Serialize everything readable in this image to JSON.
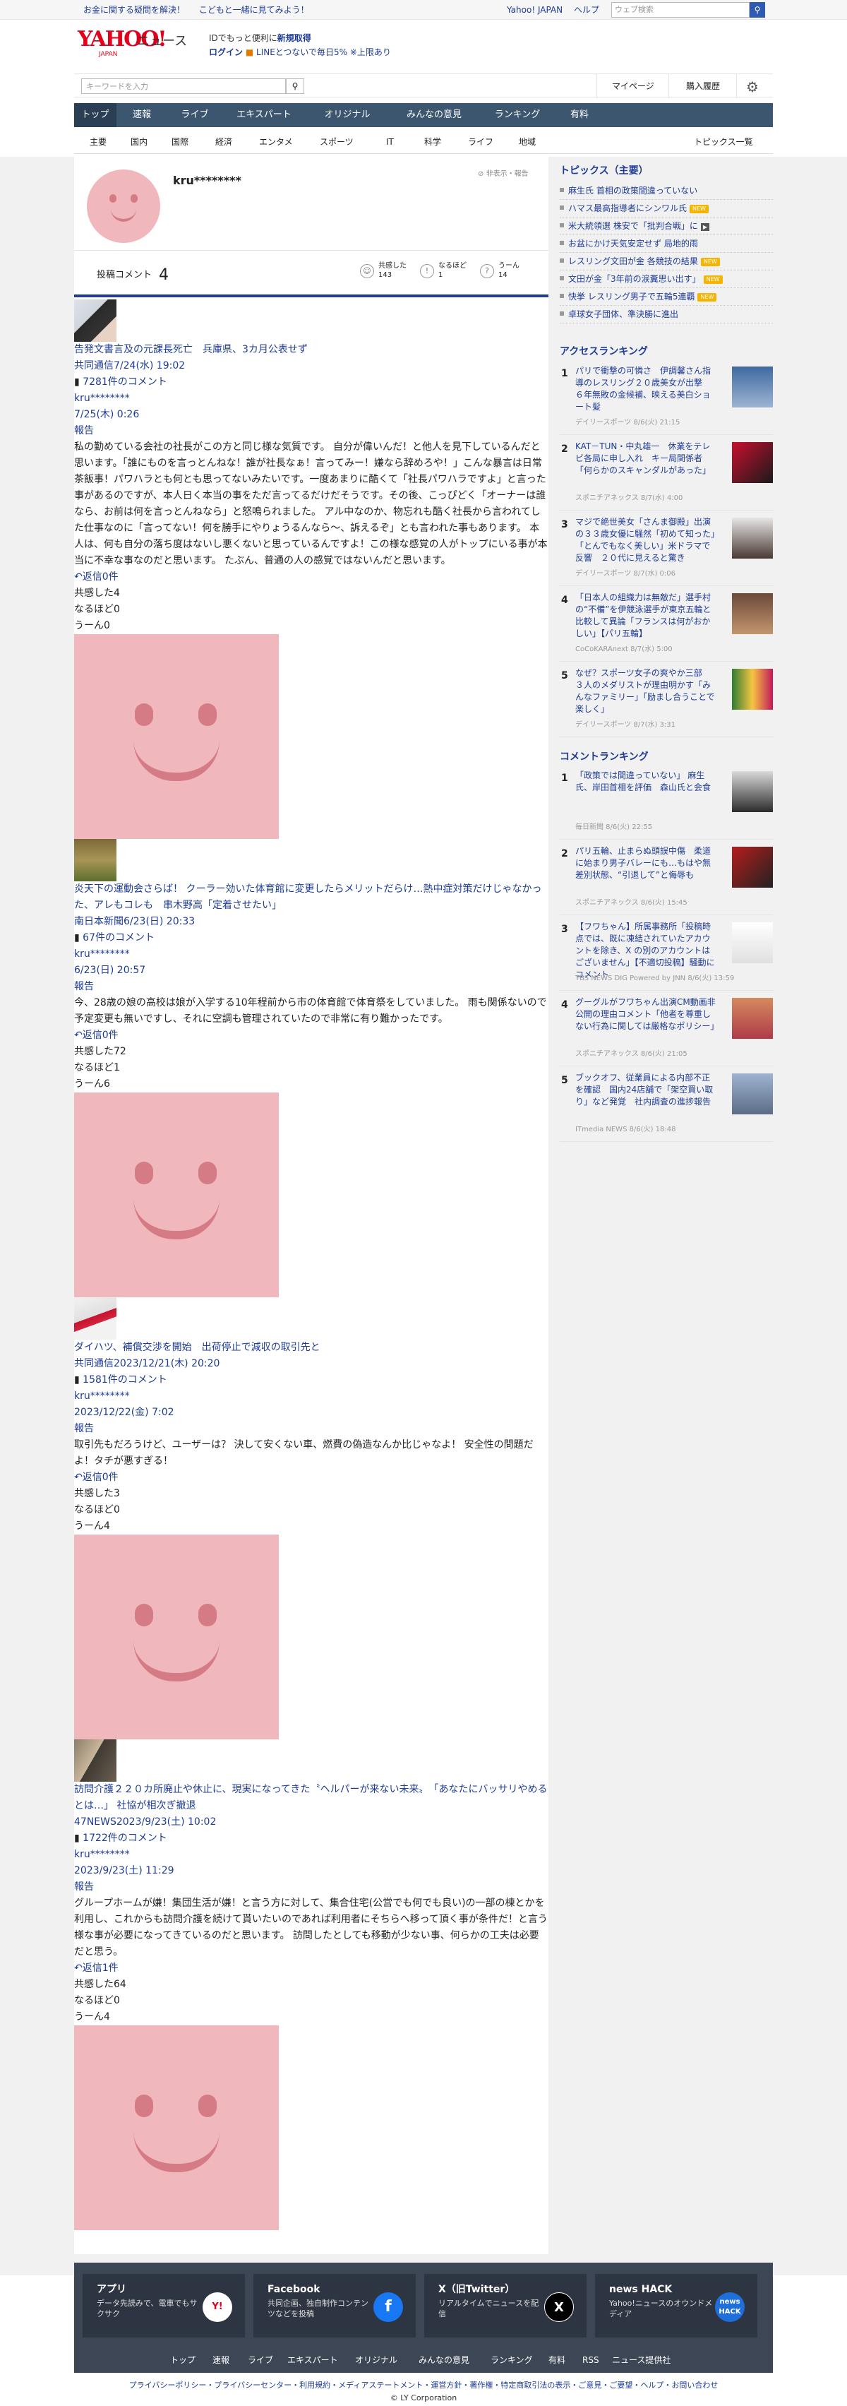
{
  "topbar": {
    "links": [
      "お金に関する疑問を解決！",
      "こどもと一緒に見てみよう！"
    ],
    "right_links": [
      "Yahoo! JAPAN",
      "ヘルプ"
    ],
    "search_placeholder": "ウェブ検索"
  },
  "header": {
    "logo": "YAHOO!",
    "logo_sub": "JAPAN",
    "service": "ニュース",
    "promo_line1_a": "IDでもっと便利に",
    "promo_line1_b": "新規取得",
    "promo_line2_a": "ログイン",
    "promo_line2_b": "LINEとつないで毎日5% ※上限あり",
    "search_placeholder": "キーワードを入力",
    "mypage": "マイページ",
    "purchase": "購入履歴"
  },
  "nav": [
    "トップ",
    "速報",
    "ライブ",
    "エキスパート",
    "オリジナル",
    "みんなの意見",
    "ランキング",
    "有料"
  ],
  "subnav": [
    "主要",
    "国内",
    "国際",
    "経済",
    "エンタメ",
    "スポーツ",
    "IT",
    "科学",
    "ライフ",
    "地域"
  ],
  "subnav_right": "トピックス一覧",
  "profile": {
    "username": "kru********",
    "report": "非表示・報告",
    "post_label": "投稿コメント",
    "post_count": "4",
    "stats": [
      {
        "icon": "thumb-up-icon",
        "label": "共感した",
        "value": "143"
      },
      {
        "icon": "bulb-icon",
        "label": "なるほど",
        "value": "1"
      },
      {
        "icon": "hmm-icon",
        "label": "うーん",
        "value": "14"
      }
    ]
  },
  "posts": [
    {
      "title": "告発文書言及の元課長死亡　兵庫県、3カ月公表せず",
      "source": "共同通信7/24(水) 19:02",
      "comments": "7281件のコメント",
      "user": "kru********",
      "date": "7/25(木) 0:26",
      "report": "報告",
      "body": "私の勤めている会社の社長がこの方と同じ様な気質です。 自分が偉いんだ！と他人を見下しているんだと思います。「誰にものを言っとんねな！誰が社長なぁ！言ってみー！嫌なら辞めろや！」こんな暴言は日常茶飯事！パワハラとも何とも思ってないみたいです。一度あまりに酷くて「社長パワハラですよ」と言った事があるのですが、本人日く本当の事をただ言ってるだけだそうです。その後、こっぴどく「オーナーは誰なら、お前は何を言っとんねなら」と怒鳴られました。 アル中なのか、物忘れも酷く社長から言われてした仕事なのに「言ってない！何を勝手にやりょうるんなら～、訴えるぞ」とも言われた事もあります。 本人は、何も自分の落ち度はないし悪くないと思っているんですよ！この様な感覚の人がトップにいる事が本当に不幸な事なのだと思います。 たぶん、普通の人の感覚ではないんだと思います。",
      "reply": "返信0件",
      "reactions": [
        "共感した4",
        "なるほど0",
        "うーん0"
      ]
    },
    {
      "title": "炎天下の運動会さらば！ クーラー効いた体育館に変更したらメリットだらけ…熱中症対策だけじゃなかった、アレもコレも　串木野高「定着させたい」",
      "source": "南日本新聞6/23(日) 20:33",
      "comments": "67件のコメント",
      "user": "kru********",
      "date": "6/23(日) 20:57",
      "report": "報告",
      "body": "今、28歳の娘の高校は娘が入学する10年程前から市の体育館で体育祭をしていました。 雨も関係ないので予定変更も無いですし、それに空調も管理されていたので非常に有り難かったです。",
      "reply": "返信0件",
      "reactions": [
        "共感した72",
        "なるほど1",
        "うーん6"
      ]
    },
    {
      "title": "ダイハツ、補償交渉を開始　出荷停止で減収の取引先と",
      "source": "共同通信2023/12/21(木) 20:20",
      "comments": "1581件のコメント",
      "user": "kru********",
      "date": "2023/12/22(金) 7:02",
      "report": "報告",
      "body": "取引先もだろうけど、ユーザーは？ 決して安くない車、燃費の偽造なんか比じゃなよ！ 安全性の問題だよ！タチが悪すぎる！",
      "reply": "返信0件",
      "reactions": [
        "共感した3",
        "なるほど0",
        "うーん4"
      ]
    },
    {
      "title": "訪問介護２２０カ所廃止や休止に、現実になってきた〝ヘルパーが来ない未来〟　「あなたにバッサリやめるとは…」 社協が相次ぎ撤退",
      "source": "47NEWS2023/9/23(土) 10:02",
      "comments": "1722件のコメント",
      "user": "kru********",
      "date": "2023/9/23(土) 11:29",
      "report": "報告",
      "body": "グループホームが嫌！集団生活が嫌！と言う方に対して、集合住宅(公営でも何でも良い)の一部の棟とかを利用し、これからも訪問介護を続けて貰いたいのであれば利用者にそちらへ移って頂く事が条件だ！と言う様な事が必要になってきているのだと思います。 訪問したとしても移動が少ない事、何らかの工夫は必要だと思う。",
      "reply": "返信1件",
      "reactions": [
        "共感した64",
        "なるほど0",
        "うーん4"
      ]
    }
  ],
  "topics": {
    "heading": "トピックス（主要）",
    "items": [
      {
        "text": "麻生氏 首相の政策間違っていない",
        "badge": ""
      },
      {
        "text": "ハマス最高指導者にシンワル氏",
        "badge": "NEW"
      },
      {
        "text": "米大統領選 株安で「批判合戦」に",
        "badge": "photo"
      },
      {
        "text": "お盆にかけ天気安定せず 局地的雨",
        "badge": ""
      },
      {
        "text": "レスリング文田が金 各競技の結果",
        "badge": "NEW"
      },
      {
        "text": "文田が金「3年前の涙糞思い出す」",
        "badge": "NEW"
      },
      {
        "text": "快挙 レスリング男子で五輪5連覇",
        "badge": "NEW"
      },
      {
        "text": "卓球女子団体、準決勝に進出",
        "badge": ""
      }
    ]
  },
  "access_ranking": {
    "heading": "アクセスランキング",
    "items": [
      {
        "rank": "1",
        "title": "パリで衝撃の可憐さ　伊調馨さん指導のレスリング２０歳美女が出撃　６年無敗の金候補、映える美白ショート髪",
        "meta": "デイリースポーツ 8/6(火) 21:15"
      },
      {
        "rank": "2",
        "title": "KAT－TUN・中丸雄一　休業をテレビ各局に申し入れ　キー局関係者「何らかのスキャンダルがあった」",
        "meta": "スポニチアネックス 8/7(水) 4:00"
      },
      {
        "rank": "3",
        "title": "マジで絶世美女「さんま御殿」出演の３３歳女優に騒然「初めて知った」「とんでもなく美しい」米ドラマで反響　２０代に見えると驚き",
        "meta": "デイリースポーツ 8/7(水) 0:06"
      },
      {
        "rank": "4",
        "title": "「日本人の組織力は無敵だ」選手村の“不備”を伊競泳選手が東京五輪と比較して異論「フランスは何がおかしい」【パリ五輪】",
        "meta": "CoCoKARAnext 8/7(水) 5:00"
      },
      {
        "rank": "5",
        "title": "なぜ？スポーツ女子の爽やか三部　３人のメダリストが理由明かす「みんなファミリー」「励まし合うことで楽しく」",
        "meta": "デイリースポーツ 8/7(水) 3:31"
      }
    ]
  },
  "comment_ranking": {
    "heading": "コメントランキング",
    "items": [
      {
        "rank": "1",
        "title": "「政策では間違っていない」 麻生氏、岸田首相を評価　森山氏と会食",
        "meta": "毎日新聞 8/6(火) 22:55"
      },
      {
        "rank": "2",
        "title": "パリ五輪、止まらぬ頭誤中傷　柔道に始まり男子バレーにも…もはや無差別状態、“引退して”と侮辱も",
        "meta": "スポニチアネックス 8/6(火) 15:45"
      },
      {
        "rank": "3",
        "title": "【フワちゃん】所属事務所「投稿時点では、既に凍結されていたアカウントを除き、X の別のアカウントはございません」【不適切投稿】騒動にコメント",
        "meta": "TBS NEWS DIG Powered by JNN 8/6(火) 13:59"
      },
      {
        "rank": "4",
        "title": "グーグルがフワちゃん出演CM動画非公開の理由コメント「他者を尊重しない行為に関しては厳格なポリシー」",
        "meta": "スポニチアネックス 8/6(火) 21:05"
      },
      {
        "rank": "5",
        "title": "ブックオフ、従業員による内部不正を確認　国内24店舗で「架空買い取り」など発覚　社内調査の進捗報告",
        "meta": "ITmedia NEWS 8/6(火) 18:48"
      }
    ]
  },
  "footer": {
    "cards": [
      {
        "title": "アプリ",
        "desc": "データ先読みで、電車でもサクサク",
        "icon": "app-icon"
      },
      {
        "title": "Facebook",
        "desc": "共同企画、独自制作コンテンツなどを投稿",
        "icon": "facebook-icon"
      },
      {
        "title": "X（旧Twitter）",
        "desc": "リアルタイムでニュースを配信",
        "icon": "x-icon"
      },
      {
        "title": "news HACK",
        "desc": "Yahoo!ニュースのオウンドメディア",
        "icon": "news-hack-icon"
      }
    ],
    "nav": [
      "トップ",
      "速報",
      "ライブ",
      "エキスパート",
      "オリジナル",
      "みんなの意見",
      "ランキング",
      "有料",
      "RSS",
      "ニュース提供社"
    ],
    "legal": "プライバシーポリシー・プライバシーセンター・利用規約・メディアステートメント・運営方針・著作権・特定商取引法の表示・ご意見・ご要望・ヘルプ・お問い合わせ",
    "copyright": "© LY Corporation"
  }
}
